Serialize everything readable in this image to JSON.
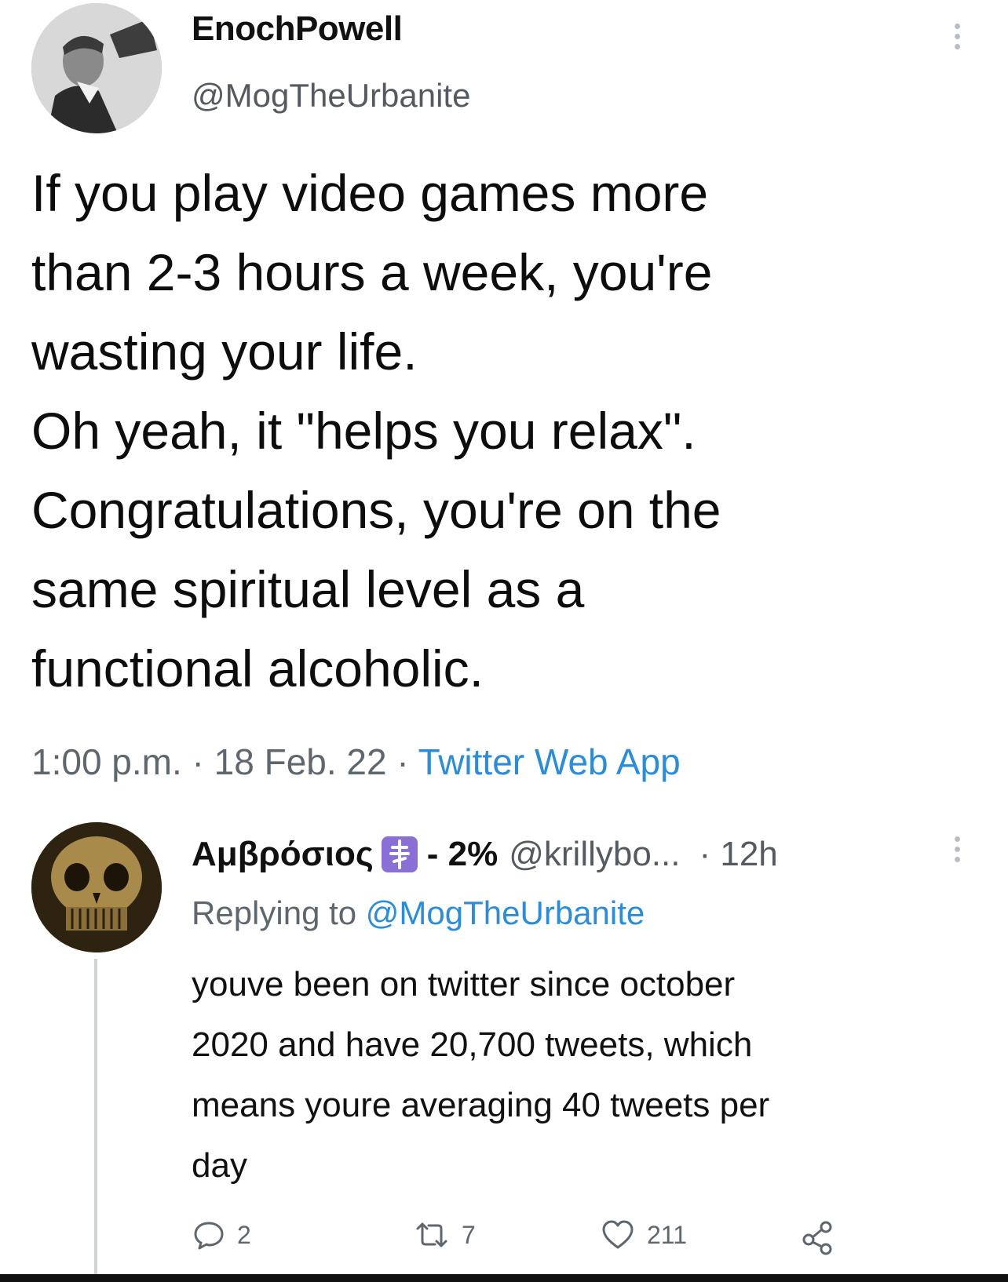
{
  "main_tweet": {
    "display_name": "EnochPowell",
    "handle": "@MogTheUrbanite",
    "text_lines": [
      "If you play video games more",
      "than 2-3 hours a week, you're",
      "wasting your life.",
      "Oh yeah, it \"helps you relax\".",
      "Congratulations, you're on the",
      "same spiritual level as a",
      "functional alcoholic."
    ],
    "meta": {
      "time_date": "1:00 p.m. · 18 Feb. 22 · ",
      "source": "Twitter Web App"
    },
    "avatar_icon": "person-photo-icon",
    "more_icon": "more-vertical-icon"
  },
  "reply": {
    "display_name": "Αμβρόσιος",
    "badge_icon": "orthodox-cross-icon",
    "tag": "- 2%",
    "handle": "@krillybo...",
    "time": "· 12h",
    "replying_prefix": "Replying to ",
    "replying_mention": "@MogTheUrbanite",
    "text_lines": [
      "youve been on twitter since october",
      "2020 and have 20,700 tweets, which",
      "means youre averaging 40 tweets per",
      "day"
    ],
    "avatar_icon": "skull-icon",
    "actions": {
      "reply_count": "2",
      "retweet_count": "7",
      "like_count": "211"
    },
    "colors": {
      "badge": "#8a6fd6",
      "link": "#2a8ddb"
    }
  }
}
